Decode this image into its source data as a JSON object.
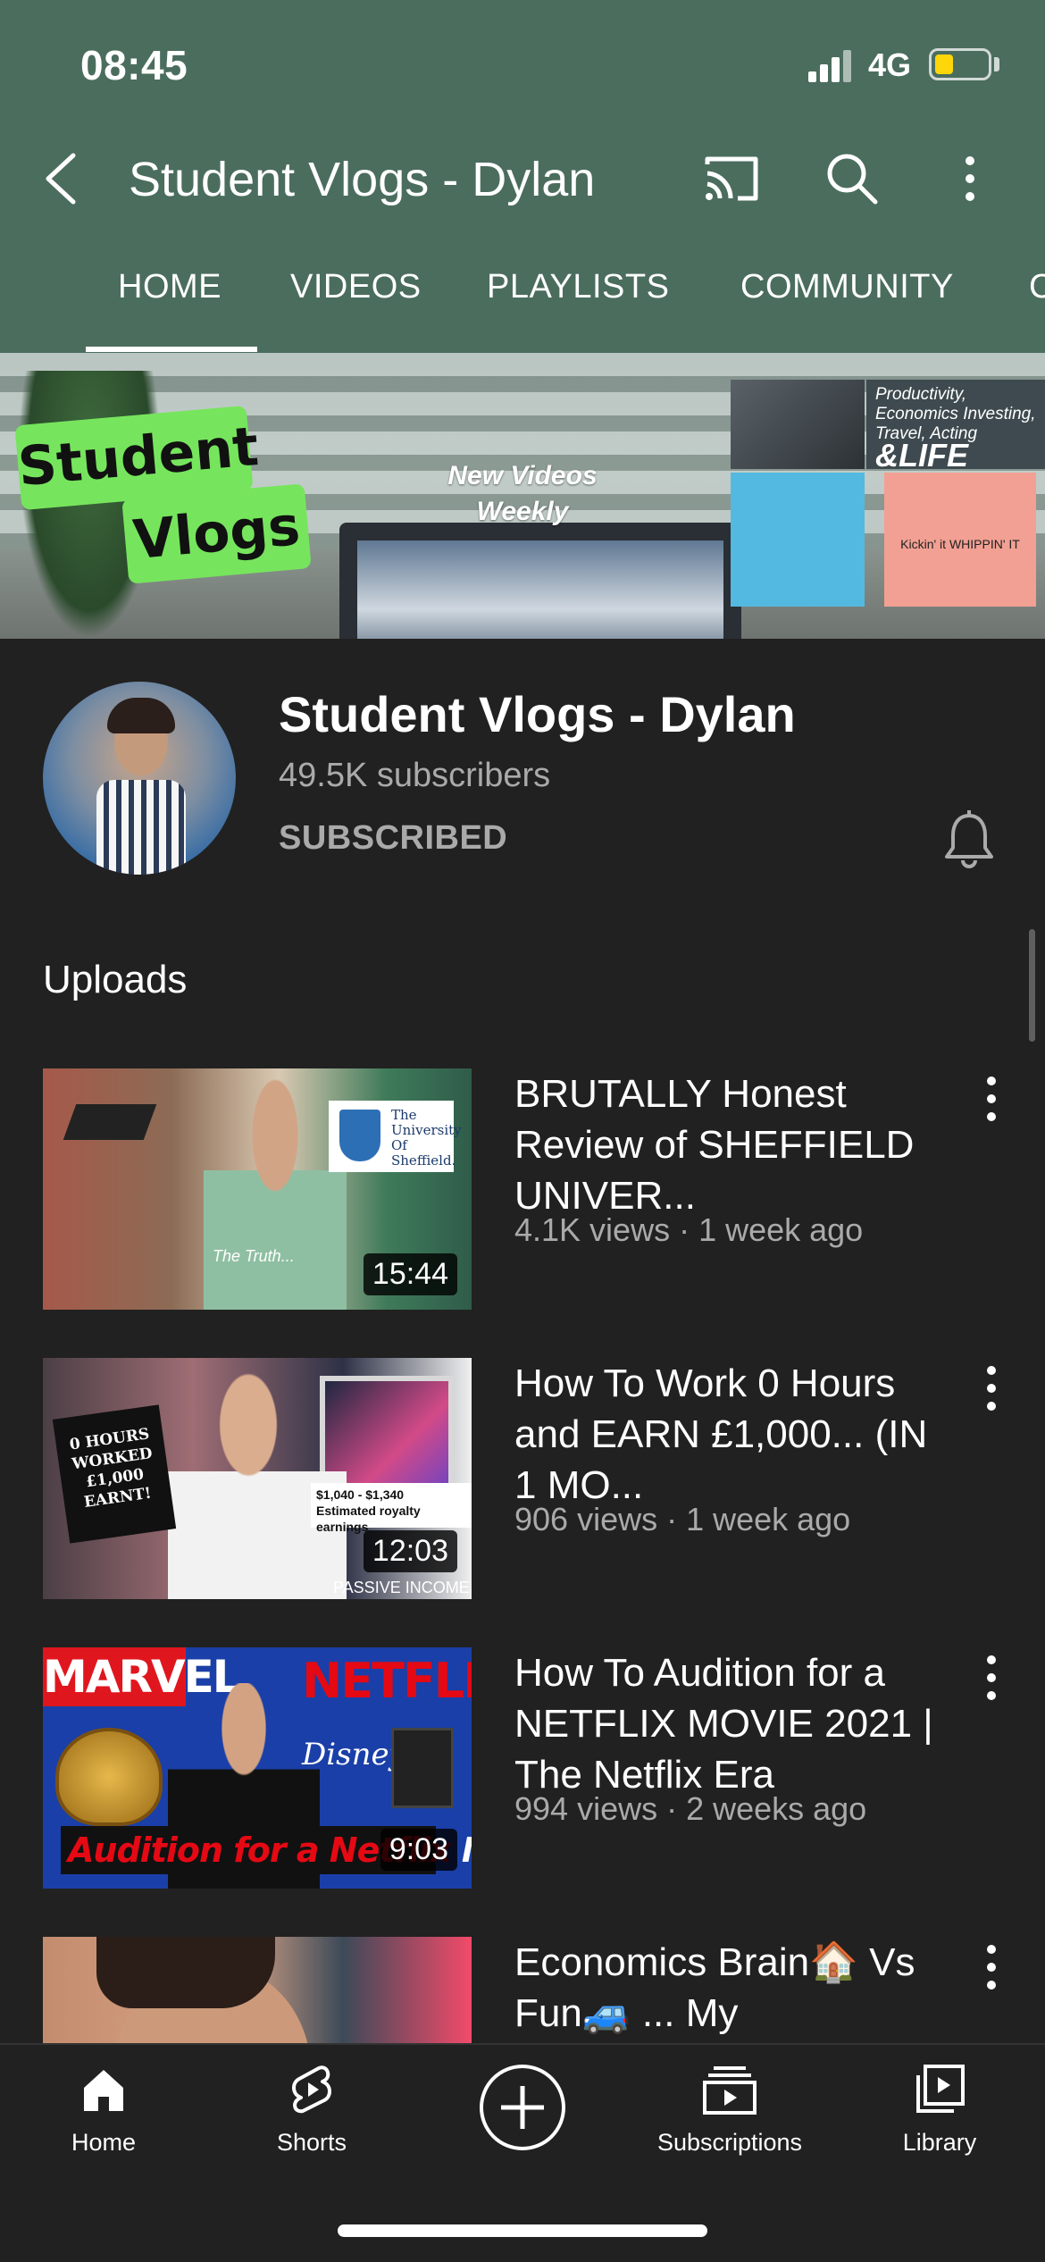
{
  "status_bar": {
    "time": "08:45",
    "network": "4G",
    "battery_color": "#ffd60a"
  },
  "header": {
    "title": "Student Vlogs - Dylan",
    "bg_color": "#4b6d5e"
  },
  "tabs": [
    {
      "label": "HOME",
      "active": true
    },
    {
      "label": "VIDEOS"
    },
    {
      "label": "PLAYLISTS"
    },
    {
      "label": "COMMUNITY"
    },
    {
      "label": "C"
    }
  ],
  "banner": {
    "sticker_line1": "Student",
    "sticker_line2": "Vlogs",
    "tagline_line1": "New Videos",
    "tagline_line2": "Weekly",
    "collage_caption": "Productivity, Economics Investing, Travel, Acting",
    "collage_big": "&LIFE",
    "collage_small": "Kickin' it WHIPPIN' IT"
  },
  "channel": {
    "name": "Student Vlogs - Dylan",
    "subscribers": "49.5K subscribers",
    "subscribe_status": "SUBSCRIBED"
  },
  "uploads": {
    "title": "Uploads",
    "videos": [
      {
        "title": "BRUTALLY Honest Review of SHEFFIELD UNIVER...",
        "meta": "4.1K views · 1 week ago",
        "duration": "15:44",
        "thumb_text": [
          "The University Of Sheffield.",
          "The Truth..."
        ]
      },
      {
        "title": "How To Work 0 Hours and EARN £1,000...  (IN 1 MO...",
        "meta": "906 views · 1 week ago",
        "duration": "12:03",
        "thumb_text": [
          "0 HOURS WORKED £1,000 EARNT!",
          "$1,040 - $1,340 Estimated royalty earnings",
          "PASSIVE INCOME"
        ]
      },
      {
        "title": "How To Audition for a NETFLIX MOVIE 2021 | The Netflix Era",
        "meta": "994 views · 2 weeks ago",
        "duration": "9:03",
        "thumb_text": [
          "MARVEL",
          "NETFLIX",
          "Disney+",
          "Audition for a",
          "Netflix",
          "Movie"
        ]
      },
      {
        "title": "Economics Brain🏠 Vs Fun🚙 ... My",
        "meta": "",
        "duration": "",
        "thumb_text": []
      }
    ]
  },
  "bottom_nav": [
    {
      "label": "Home",
      "icon": "home-icon"
    },
    {
      "label": "Shorts",
      "icon": "shorts-icon"
    },
    {
      "label": "",
      "icon": "create-icon"
    },
    {
      "label": "Subscriptions",
      "icon": "subscriptions-icon"
    },
    {
      "label": "Library",
      "icon": "library-icon"
    }
  ]
}
